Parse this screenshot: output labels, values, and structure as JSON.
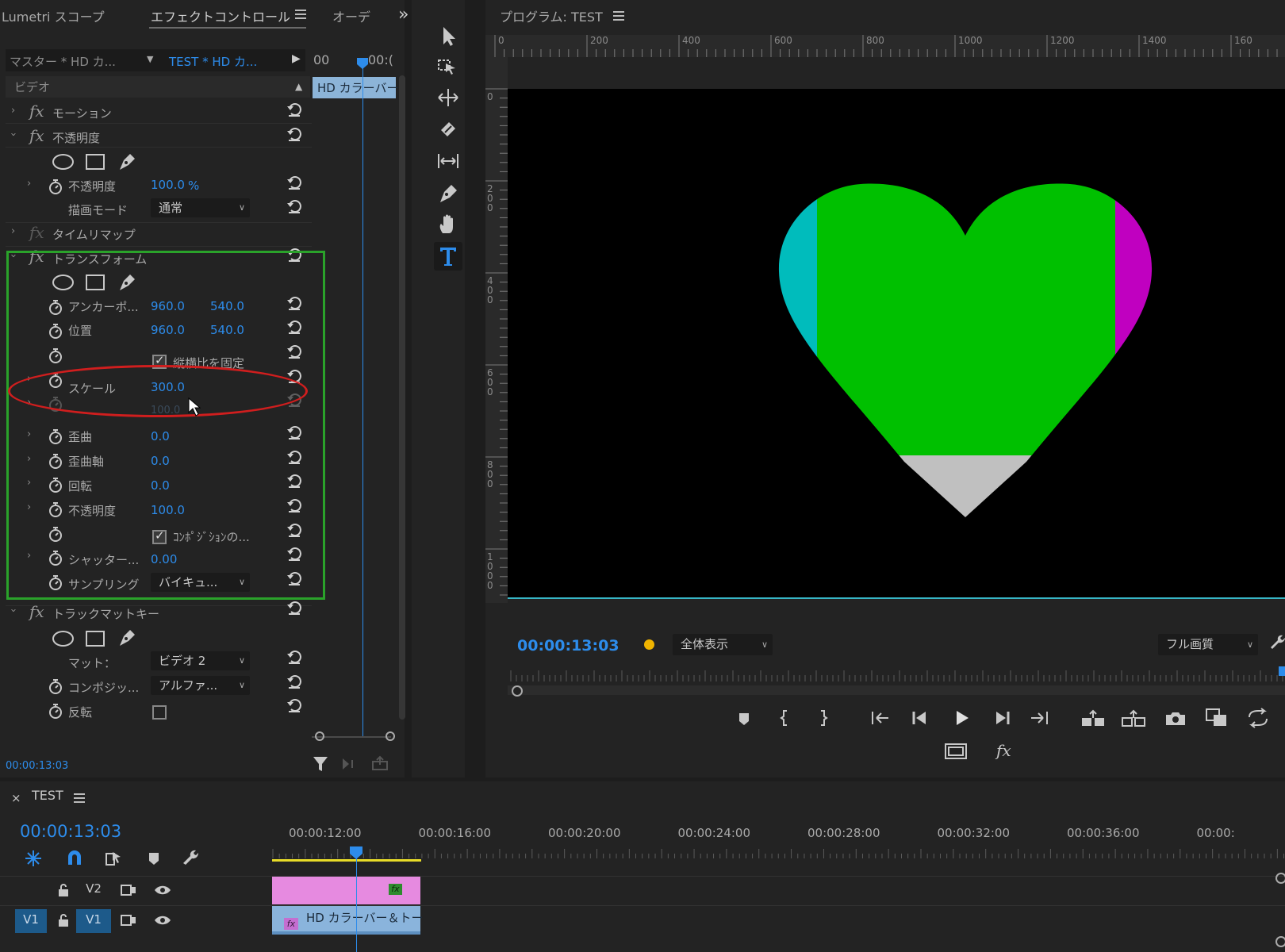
{
  "effects_panel": {
    "tabs": {
      "lumetri": "Lumetri スコープ",
      "effect_controls": "エフェクトコントロール",
      "audio": "オーデ"
    },
    "expand_label": "»",
    "master_clip": "マスター * HD カ...",
    "seq_clip": "TEST * HD カ...",
    "mini_tl_tick0": "00",
    "mini_tl_tick1": "00:(",
    "mini_clip_label": "HD カラーバー",
    "section_video": "ビデオ",
    "motion": "モーション",
    "opacity_fx": "不透明度",
    "opacity_label": "不透明度",
    "opacity_value": "100.0",
    "opacity_unit": "%",
    "blend_mode_label": "描画モード",
    "blend_mode_value": "通常",
    "time_remap": "タイムリマップ",
    "transform": "トランスフォーム",
    "anchor_label": "アンカーポ...",
    "anchor_x": "960.0",
    "anchor_y": "540.0",
    "position_label": "位置",
    "position_x": "960.0",
    "position_y": "540.0",
    "uniform_scale_label": "縦横比を固定",
    "scale_label": "スケール",
    "scale_value": "300.0",
    "scale_width_value": "100.0",
    "skew_label": "歪曲",
    "skew_value": "0.0",
    "skew_axis_label": "歪曲軸",
    "skew_axis_value": "0.0",
    "rotation_label": "回転",
    "rotation_value": "0.0",
    "t_opacity_label": "不透明度",
    "t_opacity_value": "100.0",
    "comp_shutter_label": "ｺﾝﾎﾟｼﾞｼｮﾝの...",
    "shutter_label": "シャッター...",
    "shutter_value": "0.00",
    "sampling_label": "サンプリング",
    "sampling_value": "バイキュ...",
    "track_matte": "トラックマットキー",
    "matte_label": "マット：",
    "matte_value": "ビデオ 2",
    "composite_label": "コンポジッ...",
    "composite_value": "アルファ...",
    "reverse_label": "反転",
    "timecode": "00:00:13:03",
    "highlight_color": "#2aa22a",
    "annotation_color": "#d01e1e"
  },
  "program_panel": {
    "title": "プログラム: TEST",
    "ruler_x": [
      "0",
      "200",
      "400",
      "600",
      "800",
      "1000",
      "1200",
      "1400",
      "160"
    ],
    "ruler_y": [
      "0",
      "200",
      "400",
      "600",
      "800",
      "1000"
    ],
    "timecode": "00:00:13:03",
    "zoom": "全体表示",
    "quality": "フル画質",
    "heart_colors": {
      "cyan": "#00bcbc",
      "green": "#00c000",
      "magenta": "#c000c0",
      "gray": "#c0c0c0"
    }
  },
  "timeline": {
    "close_label": "×",
    "title": "TEST",
    "timecode": "00:00:13:03",
    "ticks": [
      "00:00:12:00",
      "00:00:16:00",
      "00:00:20:00",
      "00:00:24:00",
      "00:00:28:00",
      "00:00:32:00",
      "00:00:36:00",
      "00:00:"
    ],
    "tracks": [
      {
        "name": "V2",
        "source": ""
      },
      {
        "name": "V1",
        "source": "V1"
      }
    ],
    "v2_clip_fx": "fx",
    "v1_clip_fx": "fx",
    "v1_clip_label": "HD カラーバー＆トー"
  }
}
